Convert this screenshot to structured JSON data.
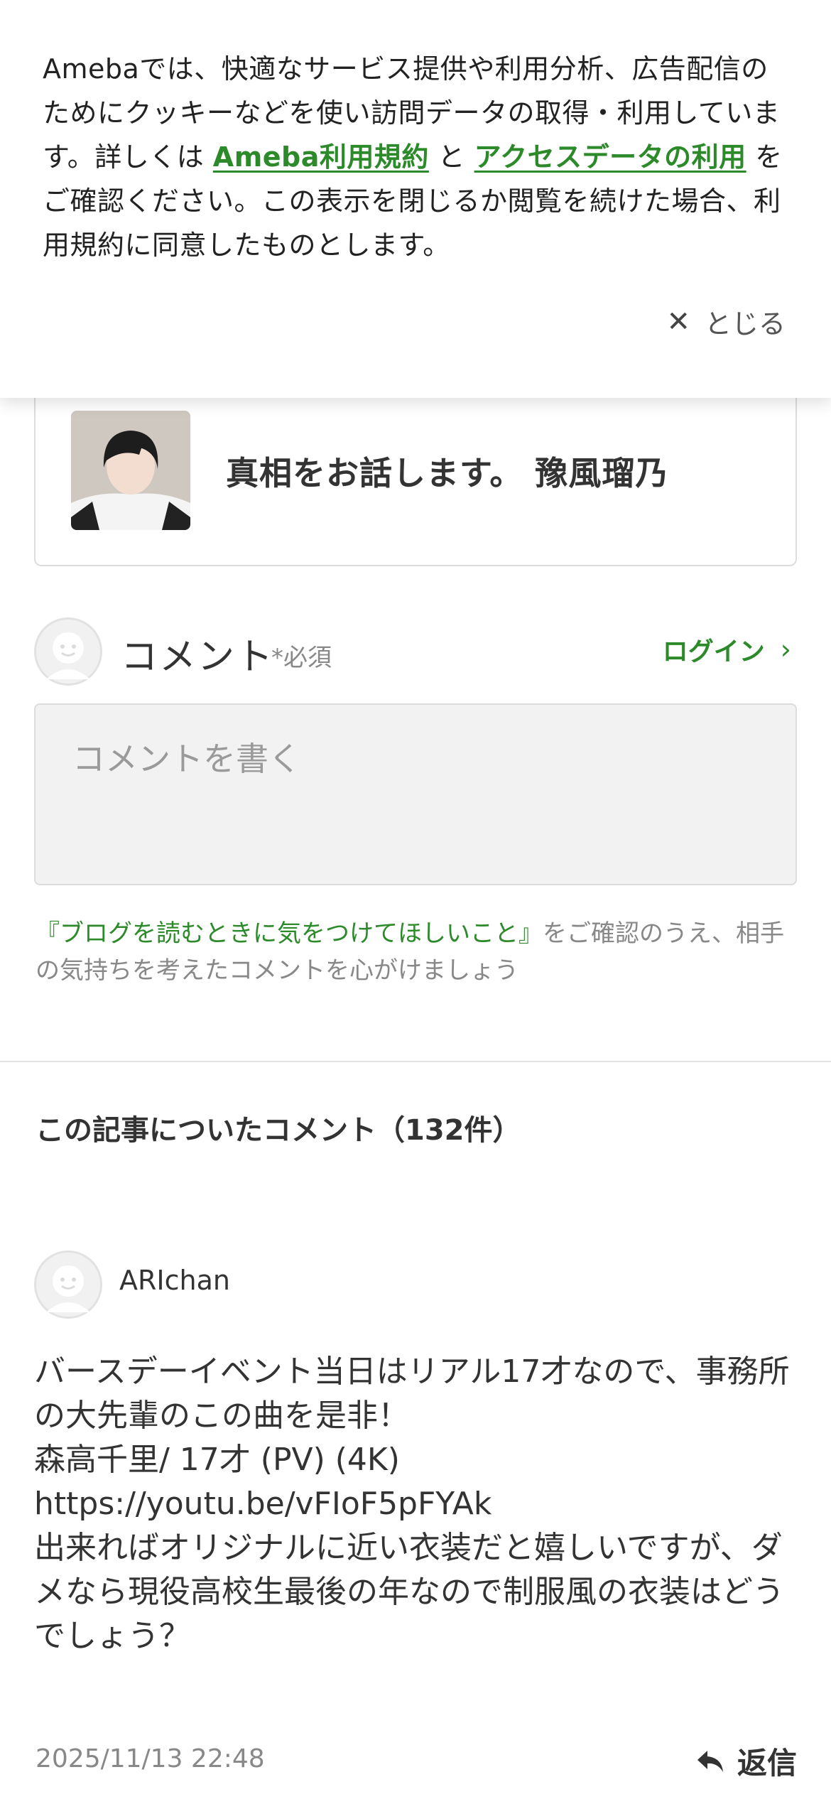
{
  "cookie_banner": {
    "text_before": "Amebaでは、快適なサービス提供や利用分析、広告配信のためにクッキーなどを使い訪問データの取得・利用しています。詳しくは ",
    "link_terms": "Ameba利用規約",
    "text_and": " と ",
    "link_access_data": "アクセスデータの利用",
    "text_after": " をご確認ください。この表示を閉じるか閲覧を続けた場合、利用規約に同意したものとします。",
    "close_label": "とじる"
  },
  "blog_card": {
    "title": "真相をお話します。 豫風瑠乃"
  },
  "comment_form": {
    "label": "コメント",
    "required": "*必須",
    "login_label": "ログイン",
    "placeholder": "コメントを書く",
    "guidelines_link": "『ブログを読むときに気をつけてほしいこと』",
    "guidelines_text": "をご確認のうえ、相手の気持ちを考えたコメントを心がけましょう"
  },
  "comments": {
    "heading": "この記事についたコメント（132件）",
    "items": [
      {
        "author": "ARIchan",
        "body": "バースデーイベント当日はリアル17才なので、事務所の大先輩のこの曲を是非！\n森高千里/ 17才 (PV) (4K)\nhttps://youtu.be/vFIoF5pFYAk\n出来ればオリジナルに近い衣装だと嬉しいですが、ダメなら現役高校生最後の年なので制服風の衣装はどうでしょう？",
        "date": "2025/11/13 22:48",
        "reply_label": "返信"
      }
    ]
  },
  "colors": {
    "accent_green": "#2d8a2a",
    "text_main": "#333333",
    "text_muted": "#888888"
  }
}
